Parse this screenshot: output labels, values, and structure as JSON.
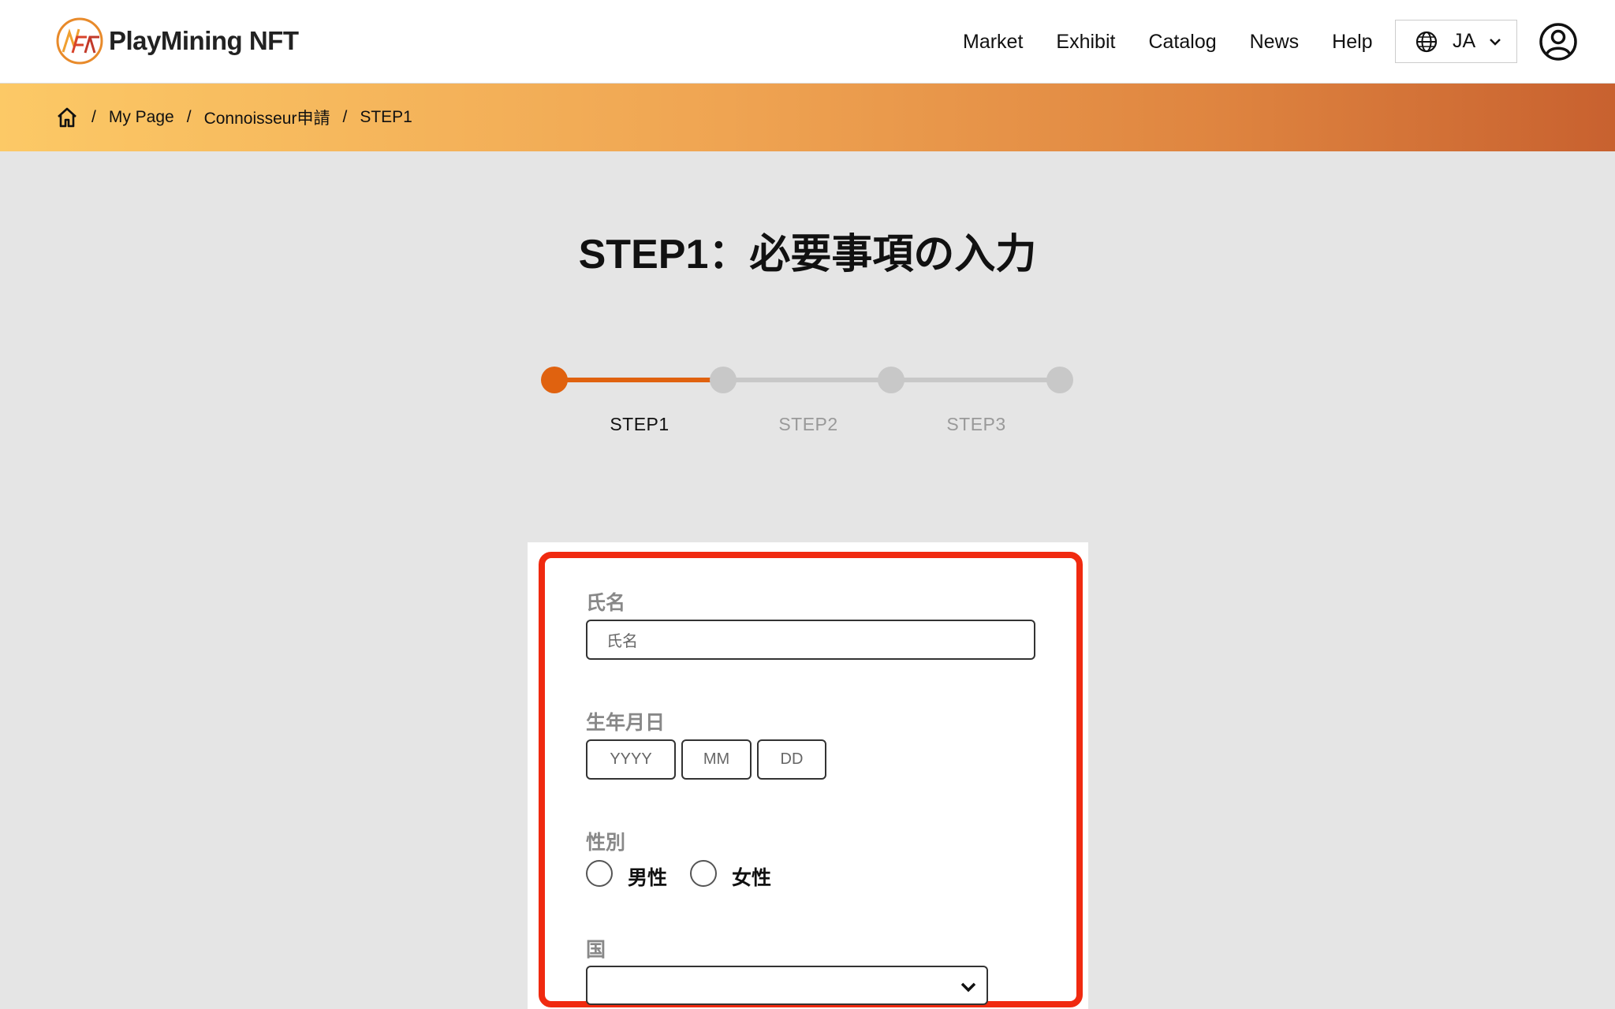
{
  "brand": {
    "name": "PlayMining NFT"
  },
  "nav": {
    "items": [
      {
        "label": "Market"
      },
      {
        "label": "Exhibit"
      },
      {
        "label": "Catalog"
      },
      {
        "label": "News"
      },
      {
        "label": "Help"
      }
    ],
    "language": "JA"
  },
  "breadcrumb": {
    "items": [
      "My Page",
      "Connoisseur申請",
      "STEP1"
    ]
  },
  "page": {
    "title": "STEP1：必要事項の入力"
  },
  "stepper": {
    "current": 1,
    "steps": [
      "STEP1",
      "STEP2",
      "STEP3"
    ],
    "active_color": "#e0620f",
    "inactive_color": "#c8c8c8"
  },
  "form": {
    "name": {
      "label": "氏名",
      "placeholder": "氏名"
    },
    "birthdate": {
      "label": "生年月日",
      "year_placeholder": "YYYY",
      "month_placeholder": "MM",
      "day_placeholder": "DD"
    },
    "gender": {
      "label": "性別",
      "options": [
        "男性",
        "女性"
      ]
    },
    "country": {
      "label": "国",
      "value": ""
    }
  },
  "colors": {
    "highlight": "#f02a10"
  }
}
